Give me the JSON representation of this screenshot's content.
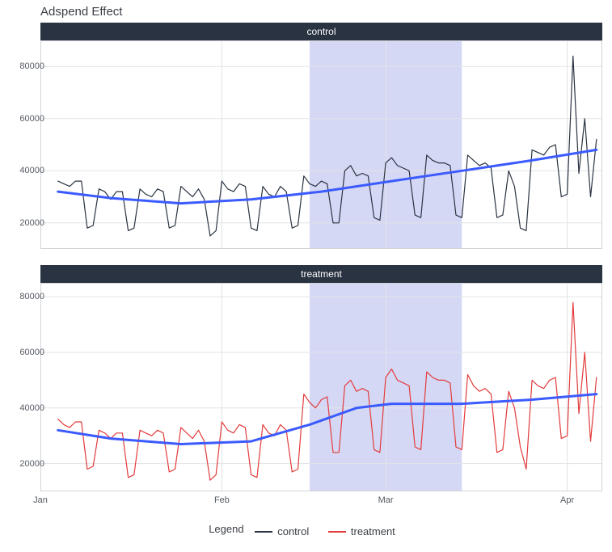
{
  "title": "Adspend Effect",
  "strip_labels": {
    "top": "control",
    "bottom": "treatment"
  },
  "legend": {
    "title": "Legend",
    "items": [
      {
        "label": "control",
        "color": "#2a3341"
      },
      {
        "label": "treatment",
        "color": "#e23b3b"
      }
    ]
  },
  "axes": {
    "x_ticks": [
      "Jan",
      "Feb",
      "Mar",
      "Apr"
    ],
    "y_ticks": [
      20000,
      40000,
      60000,
      80000
    ]
  },
  "colors": {
    "control_line": "#2a3341",
    "treatment_line": "#e23b3b",
    "smooth_line": "#3b5bff",
    "shade": "#c7cbf2",
    "grid": "#e1e3e6",
    "panel_border": "#d1d4d8",
    "strip_bg": "#2a3341"
  },
  "chart_data": [
    {
      "type": "line",
      "title": "Adspend Effect",
      "facet": "control",
      "xlabel": "",
      "ylabel": "",
      "x_range_days": [
        0,
        96
      ],
      "ylim": [
        10000,
        90000
      ],
      "x_ticks_days": {
        "Jan": 0,
        "Feb": 31,
        "Mar": 59,
        "Apr": 90
      },
      "shade_x": [
        46,
        72
      ],
      "series": [
        {
          "name": "control",
          "color": "#2a3341",
          "x": [
            3,
            4,
            5,
            6,
            7,
            8,
            9,
            10,
            11,
            12,
            13,
            14,
            15,
            16,
            17,
            18,
            19,
            20,
            21,
            22,
            23,
            24,
            25,
            26,
            27,
            28,
            29,
            30,
            31,
            32,
            33,
            34,
            35,
            36,
            37,
            38,
            39,
            40,
            41,
            42,
            43,
            44,
            45,
            46,
            47,
            48,
            49,
            50,
            51,
            52,
            53,
            54,
            55,
            56,
            57,
            58,
            59,
            60,
            61,
            62,
            63,
            64,
            65,
            66,
            67,
            68,
            69,
            70,
            71,
            72,
            73,
            74,
            75,
            76,
            77,
            78,
            79,
            80,
            81,
            82,
            83,
            84,
            85,
            86,
            87,
            88,
            89,
            90,
            91,
            92,
            93,
            94,
            95
          ],
          "y": [
            36000,
            35000,
            34000,
            36000,
            36000,
            18000,
            19000,
            33000,
            32000,
            29000,
            32000,
            32000,
            17000,
            18000,
            33000,
            31000,
            30000,
            33000,
            32000,
            18000,
            19000,
            34000,
            32000,
            30000,
            33000,
            29000,
            15000,
            17000,
            36000,
            33000,
            32000,
            35000,
            34000,
            18000,
            17000,
            34000,
            31000,
            30000,
            34000,
            32000,
            18000,
            19000,
            38000,
            35000,
            34000,
            36000,
            35000,
            20000,
            20000,
            40000,
            42000,
            38000,
            39000,
            38000,
            22000,
            21000,
            43000,
            45000,
            42000,
            41000,
            40000,
            23000,
            22000,
            46000,
            44000,
            43000,
            43000,
            42000,
            23000,
            22000,
            46000,
            44000,
            42000,
            43000,
            41000,
            22000,
            23000,
            40000,
            34000,
            18000,
            17000,
            48000,
            47000,
            46000,
            49000,
            50000,
            30000,
            31000,
            84000,
            39000,
            60000,
            30000,
            52000
          ]
        },
        {
          "name": "smooth",
          "color": "#3b5bff",
          "x": [
            3,
            12,
            24,
            36,
            48,
            60,
            72,
            84,
            95
          ],
          "y": [
            32000,
            29500,
            27500,
            29000,
            32000,
            36000,
            40000,
            44000,
            48000
          ]
        }
      ]
    },
    {
      "type": "line",
      "title": "Adspend Effect",
      "facet": "treatment",
      "xlabel": "",
      "ylabel": "",
      "x_range_days": [
        0,
        96
      ],
      "ylim": [
        10000,
        85000
      ],
      "x_ticks_days": {
        "Jan": 0,
        "Feb": 31,
        "Mar": 59,
        "Apr": 90
      },
      "shade_x": [
        46,
        72
      ],
      "series": [
        {
          "name": "treatment",
          "color": "#e23b3b",
          "x": [
            3,
            4,
            5,
            6,
            7,
            8,
            9,
            10,
            11,
            12,
            13,
            14,
            15,
            16,
            17,
            18,
            19,
            20,
            21,
            22,
            23,
            24,
            25,
            26,
            27,
            28,
            29,
            30,
            31,
            32,
            33,
            34,
            35,
            36,
            37,
            38,
            39,
            40,
            41,
            42,
            43,
            44,
            45,
            46,
            47,
            48,
            49,
            50,
            51,
            52,
            53,
            54,
            55,
            56,
            57,
            58,
            59,
            60,
            61,
            62,
            63,
            64,
            65,
            66,
            67,
            68,
            69,
            70,
            71,
            72,
            73,
            74,
            75,
            76,
            77,
            78,
            79,
            80,
            81,
            82,
            83,
            84,
            85,
            86,
            87,
            88,
            89,
            90,
            91,
            92,
            93,
            94,
            95
          ],
          "y": [
            36000,
            34000,
            33000,
            35000,
            35000,
            18000,
            19000,
            32000,
            31000,
            29000,
            31000,
            31000,
            15000,
            16000,
            32000,
            31000,
            30000,
            32000,
            31000,
            17000,
            18000,
            33000,
            31000,
            29000,
            32000,
            28000,
            14000,
            16000,
            35000,
            32000,
            31000,
            34000,
            33000,
            16000,
            15000,
            34000,
            31000,
            30000,
            34000,
            32000,
            17000,
            18000,
            45000,
            42000,
            40000,
            43000,
            44000,
            24000,
            24000,
            48000,
            50000,
            46000,
            47000,
            46000,
            25000,
            24000,
            51000,
            54000,
            50000,
            49000,
            48000,
            26000,
            25000,
            53000,
            51000,
            50000,
            50000,
            49000,
            26000,
            25000,
            52000,
            48000,
            46000,
            47000,
            45000,
            24000,
            25000,
            46000,
            40000,
            26000,
            18000,
            50000,
            48000,
            47000,
            50000,
            51000,
            29000,
            30000,
            78000,
            38000,
            60000,
            28000,
            51000
          ]
        },
        {
          "name": "smooth",
          "color": "#3b5bff",
          "x": [
            3,
            12,
            24,
            36,
            46,
            54,
            60,
            72,
            84,
            95
          ],
          "y": [
            32000,
            29000,
            27000,
            28000,
            34000,
            40000,
            41500,
            41500,
            43000,
            45000
          ]
        }
      ]
    }
  ]
}
